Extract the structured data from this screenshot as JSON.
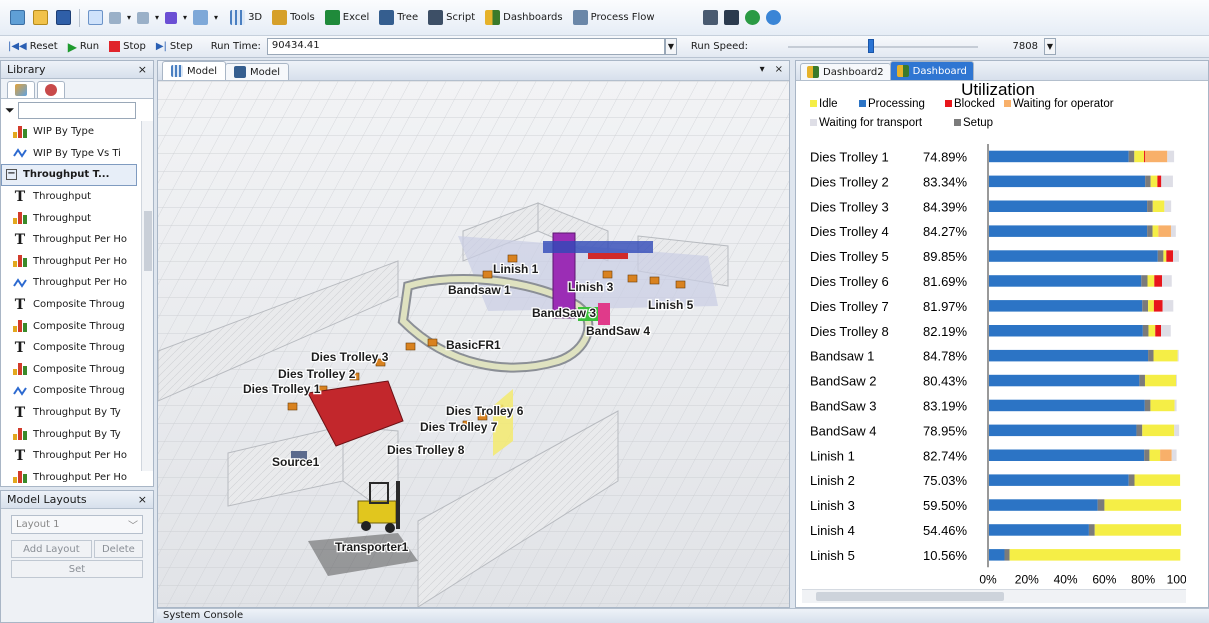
{
  "toolbar1": {
    "items": [
      {
        "label": "3D",
        "icon": "3d-view-icon"
      },
      {
        "label": "Tools",
        "icon": "tools-icon"
      },
      {
        "label": "Excel",
        "icon": "excel-icon"
      },
      {
        "label": "Tree",
        "icon": "tree-icon"
      },
      {
        "label": "Script",
        "icon": "script-icon"
      },
      {
        "label": "Dashboards",
        "icon": "dashboards-icon"
      },
      {
        "label": "Process Flow",
        "icon": "process-flow-icon"
      }
    ]
  },
  "toolbar2": {
    "reset": "Reset",
    "run": "Run",
    "stop": "Stop",
    "step": "Step",
    "run_time_label": "Run Time:",
    "run_time_value": "90434.41",
    "run_speed_label": "Run Speed:",
    "run_speed_value": "7808"
  },
  "library": {
    "title": "Library",
    "close": "×",
    "items": [
      {
        "label": "WIP By Type",
        "icon": "bar"
      },
      {
        "label": "WIP By Type Vs Ti",
        "icon": "line"
      },
      {
        "label": "Throughput T...",
        "icon": "group"
      },
      {
        "label": "Throughput",
        "icon": "text"
      },
      {
        "label": "Throughput",
        "icon": "bar"
      },
      {
        "label": "Throughput Per Ho",
        "icon": "text"
      },
      {
        "label": "Throughput Per Ho",
        "icon": "bar"
      },
      {
        "label": "Throughput Per Ho",
        "icon": "line"
      },
      {
        "label": "Composite Throug",
        "icon": "text"
      },
      {
        "label": "Composite Throug",
        "icon": "bar"
      },
      {
        "label": "Composite Throug",
        "icon": "text"
      },
      {
        "label": "Composite Throug",
        "icon": "bar"
      },
      {
        "label": "Composite Throug",
        "icon": "line"
      },
      {
        "label": "Throughput By Ty",
        "icon": "text"
      },
      {
        "label": "Throughput By Ty",
        "icon": "bar"
      },
      {
        "label": "Throughput Per Ho",
        "icon": "text"
      },
      {
        "label": "Throughput Per Ho",
        "icon": "bar"
      }
    ]
  },
  "layouts": {
    "title": "Model Layouts",
    "close": "×",
    "selected": "Layout 1",
    "add": "Add Layout",
    "delete": "Delete",
    "set": "Set"
  },
  "model": {
    "tabs": [
      "Model",
      "Model"
    ],
    "close": "×",
    "labels": {
      "linish1": "Linish 1",
      "bandsaw1": "Bandsaw 1",
      "linish3": "Linish 3",
      "linish5": "Linish 5",
      "bandsaw3": "BandSaw 3",
      "bandsaw4": "BandSaw 4",
      "basicfr1": "BasicFR1",
      "dt3": "Dies Trolley 3",
      "dt2": "Dies Trolley 2",
      "dt1": "Dies Trolley 1",
      "dt6": "Dies Trolley 6",
      "dt7": "Dies Trolley 7",
      "dt8": "Dies Trolley 8",
      "source1": "Source1",
      "transporter1": "Transporter1"
    }
  },
  "dashboard": {
    "tabs": [
      "Dashboard2",
      "Dashboard"
    ]
  },
  "chart_data": {
    "type": "bar",
    "orientation": "horizontal-stacked",
    "title": "Utilization",
    "legend": [
      {
        "name": "Idle",
        "color": "#f5ee46"
      },
      {
        "name": "Processing",
        "color": "#2c74c5"
      },
      {
        "name": "Blocked",
        "color": "#e8161b"
      },
      {
        "name": "Waiting for operator",
        "color": "#f8b06a"
      },
      {
        "name": "Waiting for transport",
        "color": "#dedee6"
      },
      {
        "name": "Setup",
        "color": "#7b7b7b"
      }
    ],
    "categories": [
      "Dies Trolley 1",
      "Dies Trolley 2",
      "Dies Trolley 3",
      "Dies Trolley 4",
      "Dies Trolley 5",
      "Dies Trolley 6",
      "Dies Trolley 7",
      "Dies Trolley 8",
      "Bandsaw 1",
      "BandSaw 2",
      "BandSaw 3",
      "BandSaw 4",
      "Linish 1",
      "Linish 2",
      "Linish 3",
      "Linish 4",
      "Linish 5"
    ],
    "labels": [
      "74.89%",
      "83.34%",
      "84.39%",
      "84.27%",
      "89.85%",
      "81.69%",
      "81.97%",
      "82.19%",
      "84.78%",
      "80.43%",
      "83.19%",
      "78.95%",
      "82.74%",
      "75.03%",
      "59.50%",
      "54.46%",
      "10.56%"
    ],
    "segment_order": [
      "Processing",
      "Setup",
      "Idle",
      "Blocked",
      "Waiting for operator",
      "Waiting for transport"
    ],
    "series": [
      {
        "name": "Processing",
        "values": [
          72.0,
          80.5,
          81.5,
          81.5,
          87.0,
          78.5,
          79.0,
          79.3,
          82.0,
          77.5,
          80.3,
          76.0,
          80.0,
          72.0,
          56.0,
          51.5,
          8.0
        ]
      },
      {
        "name": "Setup",
        "values": [
          2.9,
          2.8,
          2.9,
          2.8,
          2.9,
          3.2,
          3.0,
          2.9,
          2.8,
          2.9,
          2.9,
          3.0,
          2.7,
          3.0,
          3.5,
          3.0,
          2.6
        ]
      },
      {
        "name": "Idle",
        "values": [
          5.0,
          3.5,
          6.0,
          3.0,
          1.5,
          3.5,
          3.0,
          3.5,
          12.5,
          16.0,
          12.5,
          16.5,
          5.5,
          23.5,
          39.5,
          44.5,
          88.0
        ]
      },
      {
        "name": "Blocked",
        "values": [
          0.5,
          2.0,
          0,
          0,
          3.5,
          4.0,
          4.5,
          3.0,
          0,
          0,
          0,
          0,
          0,
          0,
          0,
          0,
          0
        ]
      },
      {
        "name": "Waiting for operator",
        "values": [
          11.5,
          0,
          0,
          6.5,
          0,
          0,
          0,
          0,
          0,
          0,
          0,
          0,
          6.0,
          0,
          0,
          0,
          0
        ]
      },
      {
        "name": "Waiting for transport",
        "values": [
          3.5,
          6.0,
          3.5,
          2.5,
          3.0,
          5.0,
          5.5,
          5.0,
          0.5,
          0.5,
          1.0,
          2.5,
          2.5,
          0,
          0,
          0,
          0
        ]
      }
    ],
    "xlim": [
      0,
      100
    ],
    "xticks": [
      "0%",
      "20%",
      "40%",
      "60%",
      "80%",
      "100%"
    ],
    "grid": false,
    "legend_position": "top"
  },
  "console": {
    "label": "System Console"
  }
}
